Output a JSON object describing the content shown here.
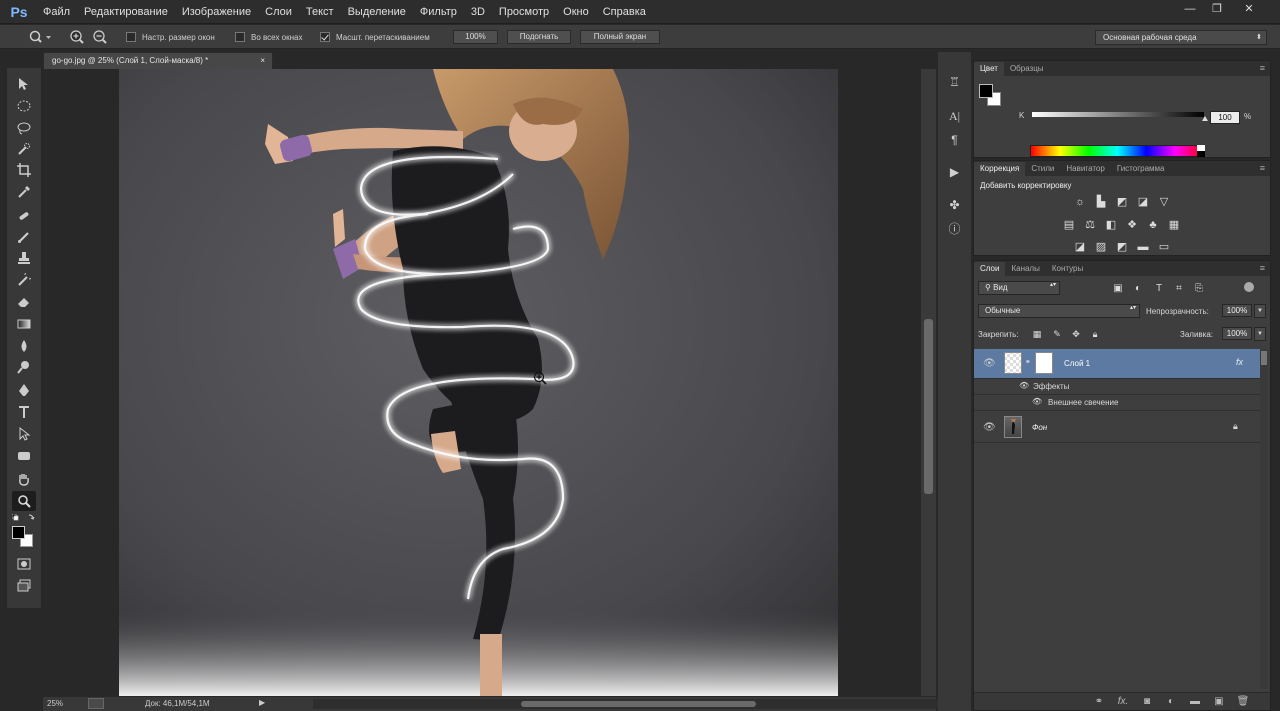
{
  "app": {
    "logo": "Ps",
    "menu": [
      "Файл",
      "Редактирование",
      "Изображение",
      "Слои",
      "Текст",
      "Выделение",
      "Фильтр",
      "3D",
      "Просмотр",
      "Окно",
      "Справка"
    ],
    "window_controls": {
      "minimize": "—",
      "restore": "❐",
      "close": "✕"
    }
  },
  "options": {
    "resize_windows": "Настр. размер окон",
    "all_windows": "Во всех окнах",
    "scrubby_zoom": "Масшт. перетаскиванием",
    "zoom_value": "100%",
    "fit_button": "Подогнать",
    "fullscreen_button": "Полный экран",
    "workspace": "Основная рабочая среда"
  },
  "document": {
    "tab_title": "go-go.jpg @ 25% (Слой 1, Слой-маска/8) *",
    "close": "×"
  },
  "status": {
    "zoom": "25%",
    "doc_size": "Док: 46,1M/54,1M"
  },
  "color_panel": {
    "tabs": [
      "Цвет",
      "Образцы"
    ],
    "channel": "K",
    "value": "100",
    "unit": "%",
    "colors": {
      "foreground": "#000000",
      "background": "#ffffff"
    }
  },
  "adjust_panel": {
    "tabs": [
      "Коррекция",
      "Стили",
      "Навигатор",
      "Гистограмма"
    ],
    "heading": "Добавить корректировку"
  },
  "layers_panel": {
    "tabs": [
      "Слои",
      "Каналы",
      "Контуры"
    ],
    "filter": "Вид",
    "blend_mode": "Обычные",
    "opacity_label": "Непрозрачность:",
    "opacity_value": "100%",
    "lock_label": "Закрепить:",
    "fill_label": "Заливка:",
    "fill_value": "100%",
    "layers": [
      {
        "name": "Слой 1",
        "fx": "fx",
        "effects_label": "Эффекты",
        "effect": "Внешнее свечение"
      },
      {
        "name": "Фон"
      }
    ]
  }
}
